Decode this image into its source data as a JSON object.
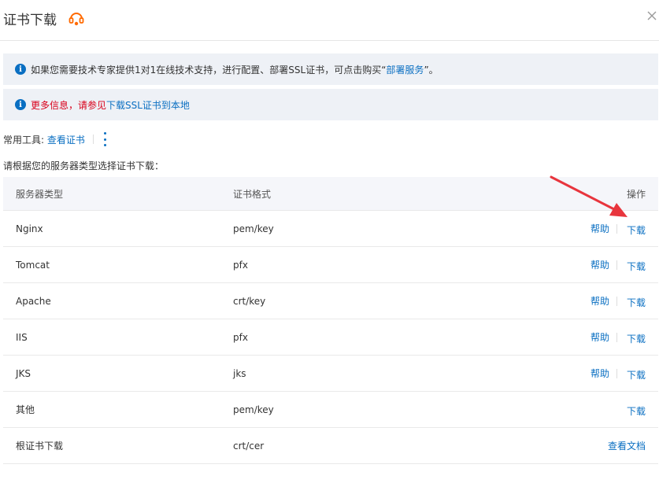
{
  "header": {
    "title": "证书下载"
  },
  "notices": [
    {
      "prefix": "如果您需要技术专家提供1对1在线技术支持，进行配置、部署SSL证书，可点击购买“",
      "link": "部署服务",
      "suffix": "”。"
    },
    {
      "red_text": "更多信息，请参见",
      "link": "下载SSL证书到本地"
    }
  ],
  "tools": {
    "label": "常用工具:",
    "link": "查看证书"
  },
  "instruction": "请根据您的服务器类型选择证书下载：",
  "table": {
    "headers": [
      "服务器类型",
      "证书格式",
      "操作"
    ],
    "rows": [
      {
        "server": "Nginx",
        "format": "pem/key",
        "help": "帮助",
        "action": "下载"
      },
      {
        "server": "Tomcat",
        "format": "pfx",
        "help": "帮助",
        "action": "下载"
      },
      {
        "server": "Apache",
        "format": "crt/key",
        "help": "帮助",
        "action": "下载"
      },
      {
        "server": "IIS",
        "format": "pfx",
        "help": "帮助",
        "action": "下载"
      },
      {
        "server": "JKS",
        "format": "jks",
        "help": "帮助",
        "action": "下载"
      },
      {
        "server": "其他",
        "format": "pem/key",
        "help": "",
        "action": "下载"
      },
      {
        "server": "根证书下载",
        "format": "crt/cer",
        "help": "",
        "action": "查看文档"
      }
    ]
  },
  "colors": {
    "link": "#0a6fc2",
    "warning": "#d9001b",
    "accent_icon": "#ff6a00",
    "arrow": "#e8353d"
  }
}
